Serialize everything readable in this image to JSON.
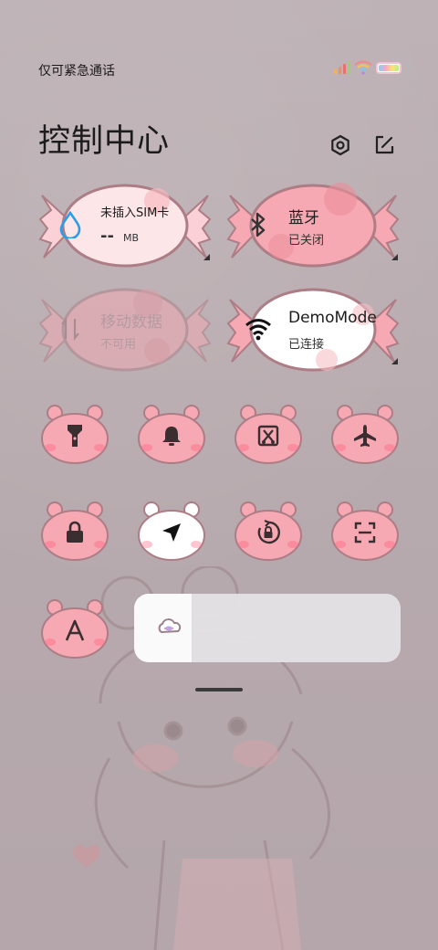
{
  "status": {
    "carrier": "仅可紧急通话"
  },
  "header": {
    "title": "控制中心"
  },
  "cards": [
    {
      "name": "未插入SIM卡",
      "value": "--",
      "unit": "MB"
    },
    {
      "name": "蓝牙",
      "sub": "已关闭"
    },
    {
      "name": "移动数据",
      "sub": "不可用"
    },
    {
      "name": "DemoMode",
      "sub": "已连接"
    }
  ],
  "toggles_row1": [
    "flashlight-icon",
    "bell-icon",
    "screenshot-icon",
    "airplane-icon"
  ],
  "toggles_row2": [
    "lock-icon",
    "location-icon",
    "rotation-lock-icon",
    "scan-icon"
  ],
  "toggles_row3": [
    "font-a-icon"
  ],
  "brightness": {
    "level": 0.22
  },
  "colors": {
    "pink": "#f6a9b3",
    "pink_light": "#fbd4d8",
    "border": "#ad7d86",
    "blue": "#2a9ee8"
  }
}
